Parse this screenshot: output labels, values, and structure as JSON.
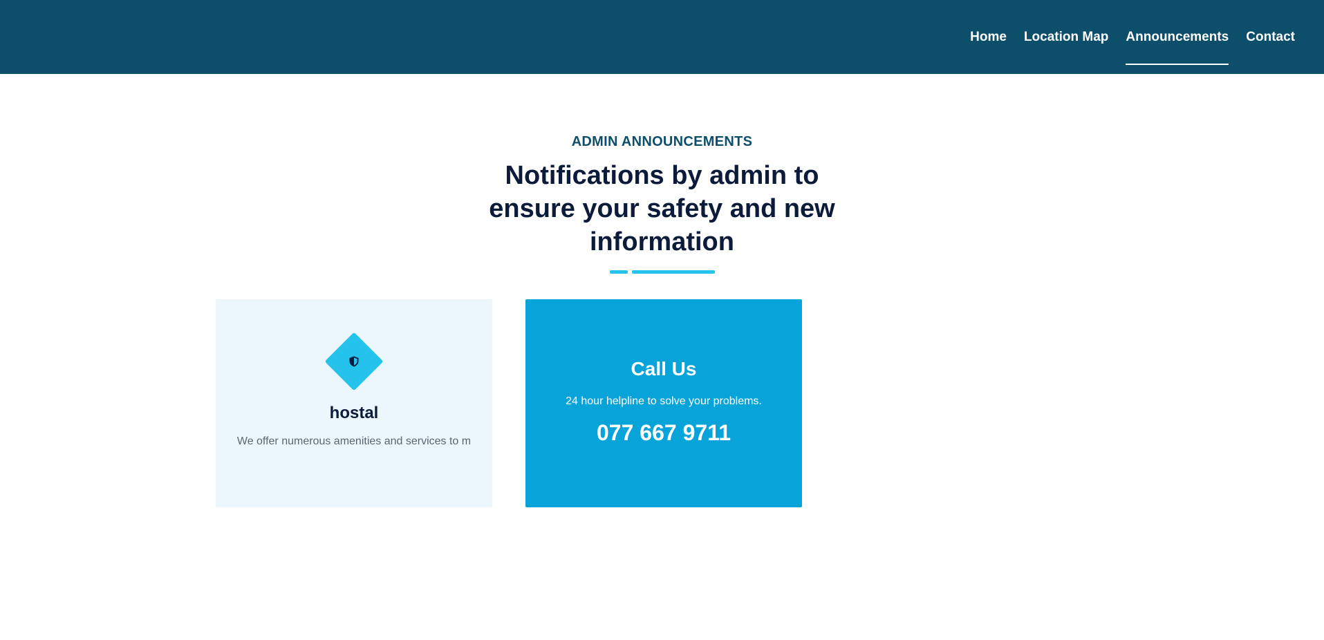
{
  "nav": {
    "items": [
      {
        "label": "Home"
      },
      {
        "label": "Location Map"
      },
      {
        "label": "Announcements",
        "active": true
      },
      {
        "label": "Contact"
      }
    ]
  },
  "section": {
    "subtitle": "ADMIN ANNOUNCEMENTS",
    "title": "Notifications by admin to ensure your safety and new information"
  },
  "cards": {
    "hostal": {
      "icon": "shield-icon",
      "title": "hostal",
      "text": "We offer numerous amenities and services to m"
    },
    "call": {
      "title": "Call Us",
      "text": "24 hour helpline to solve your problems.",
      "number": "077 667 9711"
    }
  },
  "colors": {
    "navbar": "#0d4f6b",
    "accent": "#25c2eb",
    "call_card": "#08a4d9",
    "light_card": "#ecf7fd",
    "heading": "#0c1b3a"
  }
}
